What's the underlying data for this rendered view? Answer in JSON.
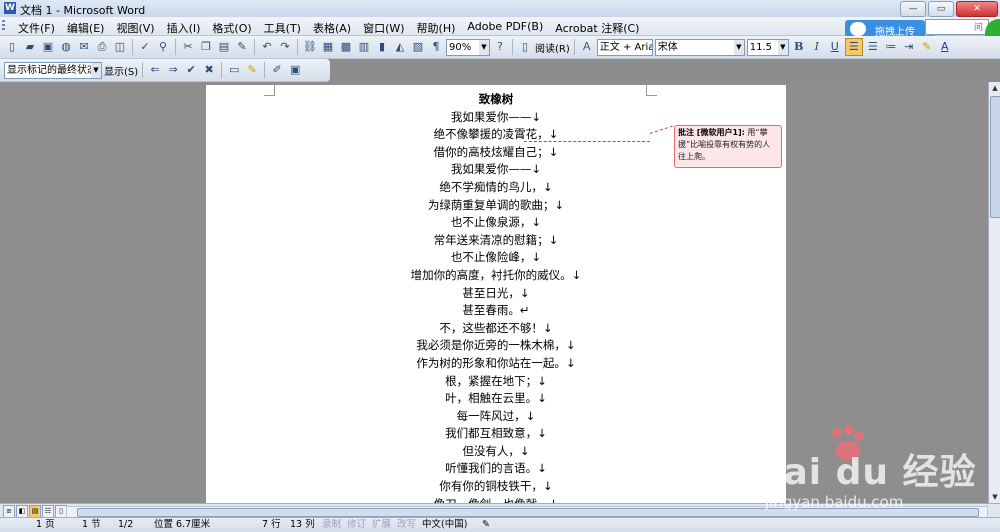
{
  "window": {
    "title": "文档 1 - Microsoft Word",
    "min_label": "—",
    "max_label": "▭",
    "close_label": "✕"
  },
  "menu": {
    "items": [
      "文件(F)",
      "编辑(E)",
      "视图(V)",
      "插入(I)",
      "格式(O)",
      "工具(T)",
      "表格(A)",
      "窗口(W)",
      "帮助(H)",
      "Adobe PDF(B)",
      "Acrobat 注释(C)"
    ]
  },
  "baidu_upload": {
    "label": "拖拽上传"
  },
  "help": {
    "placeholder": "问题"
  },
  "toolbar": {
    "zoom": "90%",
    "read_label": "阅读(R)",
    "style": "正文 + Arial",
    "font": "宋体",
    "size": "11.5",
    "bold": "B",
    "italic": "I",
    "underline": "U",
    "font_color": "A"
  },
  "review_toolbar": {
    "markup_mode": "显示标记的最终状态",
    "show_label": "显示(S)"
  },
  "document": {
    "lines": [
      "致橡树",
      "我如果爱你——↓",
      "绝不像攀援的凌霄花，↓",
      "借你的高枝炫耀自己；↓",
      "我如果爱你——↓",
      "绝不学痴情的鸟儿，↓",
      "为绿荫重复单调的歌曲；↓",
      "也不止像泉源，↓",
      "常年送来清凉的慰籍；↓",
      "也不止像险峰，↓",
      "增加你的高度，衬托你的威仪。↓",
      "甚至日光，↓",
      "甚至春雨。↵",
      "不，这些都还不够！↓",
      "我必须是你近旁的一株木棉，↓",
      "作为树的形象和你站在一起。↓",
      "根，紧握在地下；↓",
      "叶，相触在云里。↓",
      "每一阵风过，↓",
      "我们都互相致意，↓",
      "但没有人，↓",
      "听懂我们的言语。↓",
      "你有你的铜枝铁干，↓",
      "像刀，像剑，也像戟，↓"
    ],
    "comment": {
      "author": "批注 [微软用户1]:",
      "text": "用“攀援”比喻投靠有权有势的人往上爬。"
    }
  },
  "statusbar": {
    "page": "1 页",
    "section": "1 节",
    "pages": "1/2",
    "position": "位置 6.7厘米",
    "line": "7 行",
    "column": "13 列",
    "rec": "录制",
    "trk": "修订",
    "ext": "扩展",
    "ovr": "改写",
    "language": "中文(中国)"
  },
  "watermark": {
    "brand": "Bai du 经验",
    "url": "jingyan.baidu.com"
  },
  "colors": {
    "comment_fill": "#fde6e8",
    "comment_border": "#e07070",
    "baidu_blue": "#3c8fe0"
  }
}
